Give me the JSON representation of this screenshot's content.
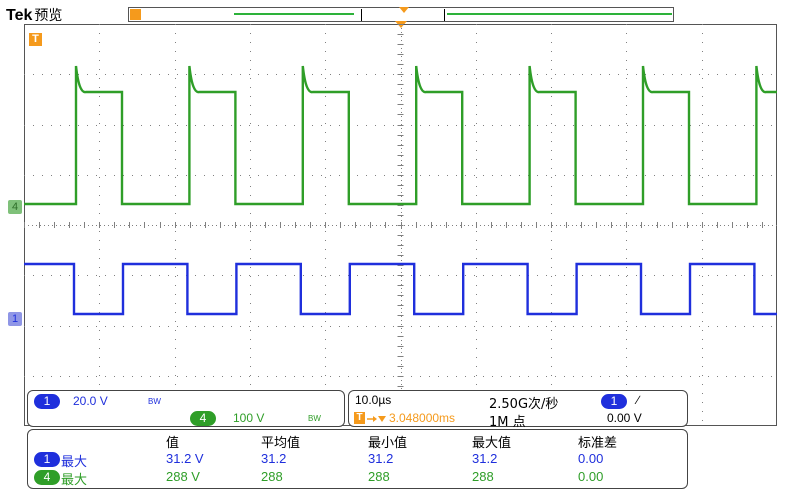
{
  "header": {
    "brand": "Tek",
    "mode": "预览"
  },
  "colors": {
    "ch1": "#1f2fdc",
    "ch4": "#2f9e28",
    "trigger": "#f59a1c",
    "grid": "#808080"
  },
  "markers": {
    "trigger": "T",
    "ch4": "4",
    "ch1": "1"
  },
  "channel_settings": {
    "ch1": {
      "label": "1",
      "scale": "20.0 V",
      "bw": "BW"
    },
    "ch4": {
      "label": "4",
      "scale": "100 V",
      "bw": "BW"
    }
  },
  "horizontal": {
    "timebase": "10.0µs",
    "sample_rate": "2.50G次/秒",
    "trigger_icon": "T",
    "trigger_delay": "3.048000ms",
    "record_length": "1M 点",
    "trigger_source": "1",
    "trigger_slope": "∕",
    "trigger_level": "0.00 V"
  },
  "measurements": {
    "headers": [
      "值",
      "平均值",
      "最小值",
      "最大值",
      "标准差"
    ],
    "rows": [
      {
        "channel": "1",
        "name": "最大",
        "value": "31.2 V",
        "mean": "31.2",
        "min": "31.2",
        "max": "31.2",
        "std": "0.00"
      },
      {
        "channel": "4",
        "name": "最大",
        "value": "288 V",
        "mean": "288",
        "min": "288",
        "max": "288",
        "std": "0.00"
      }
    ]
  }
}
